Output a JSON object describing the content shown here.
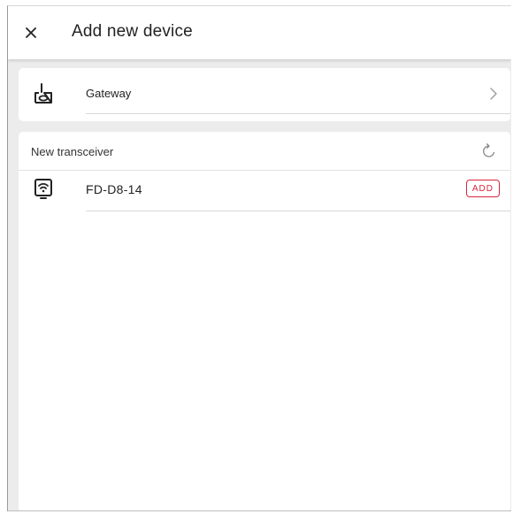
{
  "header": {
    "title": "Add new device",
    "close_icon": "close-icon"
  },
  "gateway": {
    "label": "Gateway",
    "icon": "gateway-icon",
    "chevron_icon": "chevron-right-icon"
  },
  "new_transceiver": {
    "section_title": "New transceiver",
    "refresh_icon": "refresh-icon",
    "devices": [
      {
        "name": "FD-D8-14",
        "icon": "wifi-device-icon",
        "action_label": "ADD"
      }
    ]
  },
  "colors": {
    "accent_red": "#d7263d",
    "background": "#ececec",
    "card": "#ffffff"
  }
}
